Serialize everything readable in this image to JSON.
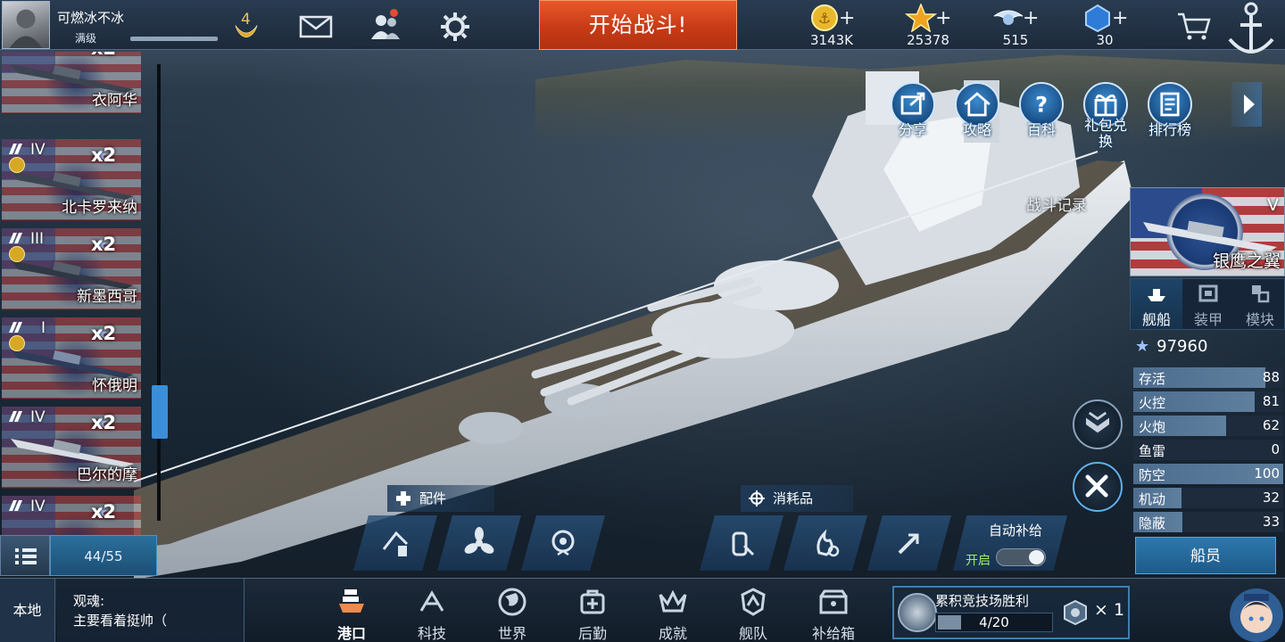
{
  "top_bar": {
    "player_name": "可燃冰不冰",
    "player_level": "满级",
    "rank_number": "4",
    "start_battle": "开始战斗!",
    "currencies": [
      {
        "icon": "gold-coin-icon",
        "value": "3143K"
      },
      {
        "icon": "star-icon",
        "value": "25378"
      },
      {
        "icon": "silver-wing-icon",
        "value": "515"
      },
      {
        "icon": "blue-gem-icon",
        "value": "30"
      }
    ],
    "plus_glyph": "+"
  },
  "ship_list": {
    "items": [
      {
        "tier": "",
        "multiplier": "x2",
        "name": "衣阿华"
      },
      {
        "tier": "IV",
        "multiplier": "x2",
        "name": "北卡罗来纳"
      },
      {
        "tier": "III",
        "multiplier": "x2",
        "name": "新墨西哥"
      },
      {
        "tier": "I",
        "multiplier": "x2",
        "name": "怀俄明"
      },
      {
        "tier": "IV",
        "multiplier": "x2",
        "name": "巴尔的摩"
      },
      {
        "tier": "IV",
        "multiplier": "x2",
        "name": ""
      }
    ],
    "count": "44/55",
    "scroll_position": 0.72
  },
  "actions": [
    {
      "label": "分享",
      "icon": "share-icon"
    },
    {
      "label": "攻略",
      "icon": "guide-home-icon"
    },
    {
      "label": "百科",
      "icon": "encyclopedia-question-icon"
    },
    {
      "label": "礼包兑换",
      "icon": "gift-exchange-icon"
    },
    {
      "label": "排行榜",
      "icon": "leaderboard-icon"
    }
  ],
  "battle_record": "战斗记录",
  "selected_ship": {
    "tier": "V",
    "name": "银鹰之翼",
    "tabs": [
      {
        "label": "舰船",
        "active": true
      },
      {
        "label": "装甲",
        "active": false
      },
      {
        "label": "模块",
        "active": false
      }
    ],
    "power": "97960",
    "stats": [
      {
        "label": "存活",
        "value": "88"
      },
      {
        "label": "火控",
        "value": "81"
      },
      {
        "label": "火炮",
        "value": "62"
      },
      {
        "label": "鱼雷",
        "value": "0"
      },
      {
        "label": "防空",
        "value": "100"
      },
      {
        "label": "机动",
        "value": "32"
      },
      {
        "label": "隐蔽",
        "value": "33"
      }
    ],
    "crew_button": "船员"
  },
  "loadout": {
    "parts_label": "配件",
    "consumables_label": "消耗品",
    "auto_supply_label": "自动补给",
    "auto_supply_state": "开启",
    "auto_supply_on": true
  },
  "bottom_bar": {
    "chat_tab": "本地",
    "chat_sender": "观魂:",
    "chat_message": "主要看着挺帅（",
    "nav": [
      {
        "label": "港口",
        "icon": "port-icon",
        "active": true
      },
      {
        "label": "科技",
        "icon": "tech-icon",
        "active": false
      },
      {
        "label": "世界",
        "icon": "world-globe-icon",
        "active": false
      },
      {
        "label": "后勤",
        "icon": "logistics-icon",
        "active": false
      },
      {
        "label": "成就",
        "icon": "achievement-icon",
        "active": false
      },
      {
        "label": "舰队",
        "icon": "fleet-icon",
        "active": false
      },
      {
        "label": "补给箱",
        "icon": "supply-box-icon",
        "active": false
      }
    ],
    "arena": {
      "title": "累积竞技场胜利",
      "progress": "4/20",
      "fraction": 0.2,
      "reward_count": "× 1"
    }
  },
  "colors": {
    "start_button": "#d9471e",
    "accent_blue": "#2d78ad",
    "stat_bar": "#5f7f9f"
  }
}
